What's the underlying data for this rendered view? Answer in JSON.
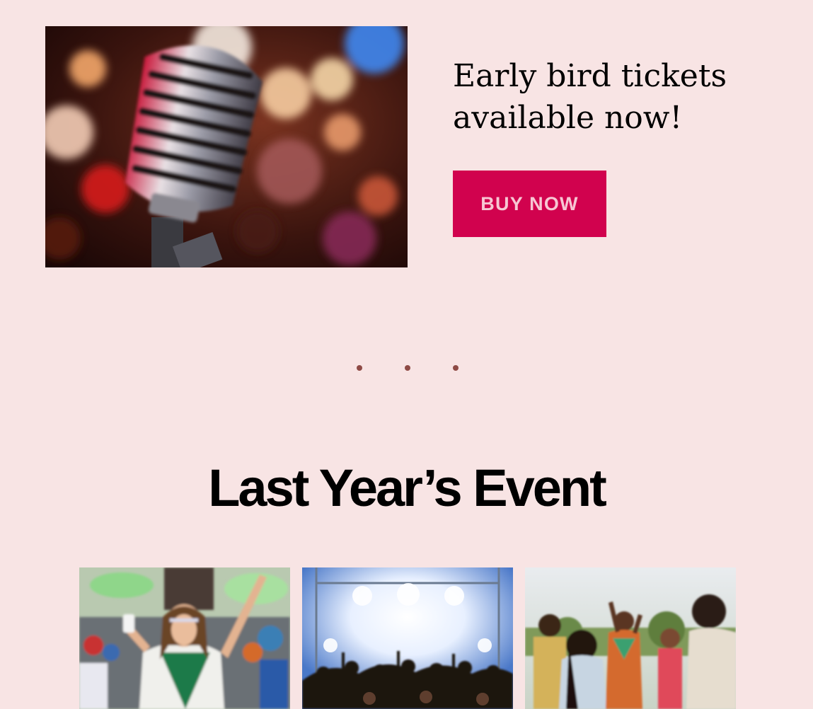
{
  "promo": {
    "image_subject": "vintage-microphone-photo",
    "heading": "Early bird tickets available now!",
    "button_label": "BUY NOW",
    "button_color": "#d1024e",
    "button_text_color": "#f7c6d3"
  },
  "separator": {
    "dot_color": "#8e4a45"
  },
  "last_year": {
    "title": "Last Year’s Event",
    "gallery": [
      {
        "subject": "festival-dancer-photo"
      },
      {
        "subject": "concert-crowd-stage-photo"
      },
      {
        "subject": "outdoor-festival-crowd-photo"
      }
    ]
  },
  "colors": {
    "page_background": "#f8e4e4",
    "heading_text": "#000000"
  }
}
